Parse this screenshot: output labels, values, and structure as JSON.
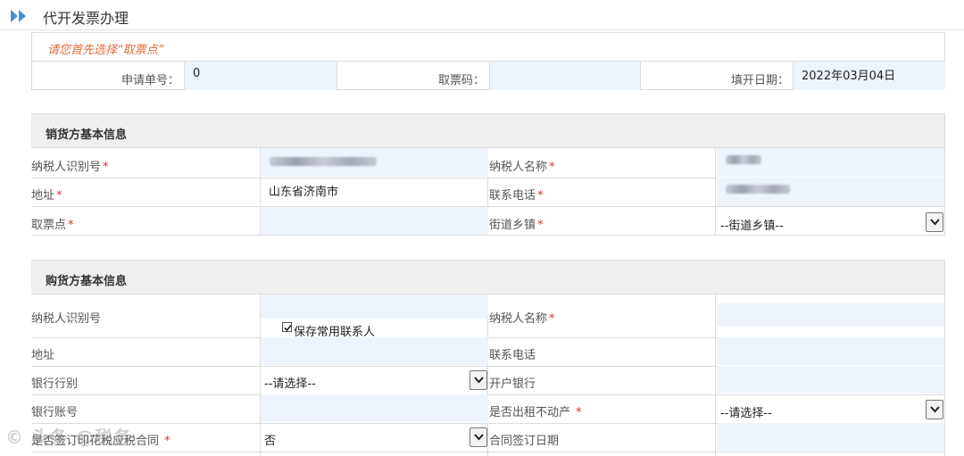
{
  "page": {
    "title": "代开发票办理"
  },
  "hint": "请您首先选择“取票点”",
  "header_fields": {
    "apply_no_label": "申请单号：",
    "apply_no_value": "0",
    "pickup_code_label": "取票码：",
    "pickup_code_value": "",
    "fill_date_label": "填开日期：",
    "fill_date_value": "2022年03月04日"
  },
  "seller": {
    "section_title": "销货方基本信息",
    "taxpayer_id_label": "纳税人识别号",
    "taxpayer_name_label": "纳税人名称",
    "address_label": "地址",
    "address_value": "山东省济南市",
    "phone_label": "联系电话",
    "pickup_point_label": "取票点",
    "street_label": "街道乡镇",
    "street_select": "--街道乡镇--"
  },
  "buyer": {
    "section_title": "购货方基本信息",
    "taxpayer_id_label": "纳税人识别号",
    "save_contact_label": "保存常用联系人",
    "save_contact_checked": true,
    "taxpayer_name_label": "纳税人名称",
    "address_label": "地址",
    "phone_label": "联系电话",
    "bank_type_label": "银行行别",
    "bank_type_select": "--请选择--",
    "open_bank_label": "开户银行",
    "account_label": "银行账号",
    "rent_label": "是否出租不动产",
    "rent_select": "--请选择--",
    "contract_label": "是否签订印花税应税合同",
    "contract_select": "否",
    "contract_date_label": "合同签订日期"
  },
  "required_mark": "*",
  "watermark": "© 头条 @税务"
}
